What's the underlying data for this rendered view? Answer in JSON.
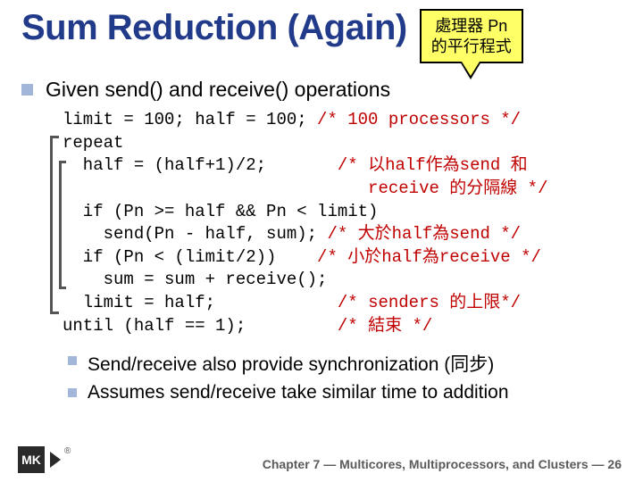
{
  "title": "Sum Reduction (Again)",
  "callout": {
    "line1": "處理器 Pn",
    "line2": "的平行程式"
  },
  "bullets": {
    "lead": "Given send() and receive() operations",
    "sub": [
      "Send/receive also provide synchronization (同步)",
      "Assumes send/receive take similar time to addition"
    ]
  },
  "code": {
    "l1a": "limit = 100; half = 100; ",
    "l1c": "/* 100 processors */",
    "l2": "repeat",
    "l3a": "  half = (half+1)/2;       ",
    "l3c": "/* 以half作為send 和",
    "l4c": "                              receive 的分隔線 */",
    "l5": "  if (Pn >= half && Pn < limit)",
    "l6a": "    send(Pn - half, sum); ",
    "l6c": "/* 大於half為send */",
    "l7a": "  if (Pn < (limit/2))    ",
    "l7c": "/* 小於half為receive */",
    "l8": "    sum = sum + receive();",
    "l9a": "  limit = half;            ",
    "l9c": "/* senders 的上限*/",
    "l10a": "until (half == 1);         ",
    "l10c": "/* 結束 */"
  },
  "footer": {
    "chapter_prefix": "Chapter 7 — ",
    "chapter_title": "Multicores, Multiprocessors, and Clusters",
    "page_sep": " — ",
    "page_num": "26"
  },
  "logo": {
    "text": "MK",
    "registered": "®"
  },
  "icons": {
    "bullet_square": "■"
  }
}
